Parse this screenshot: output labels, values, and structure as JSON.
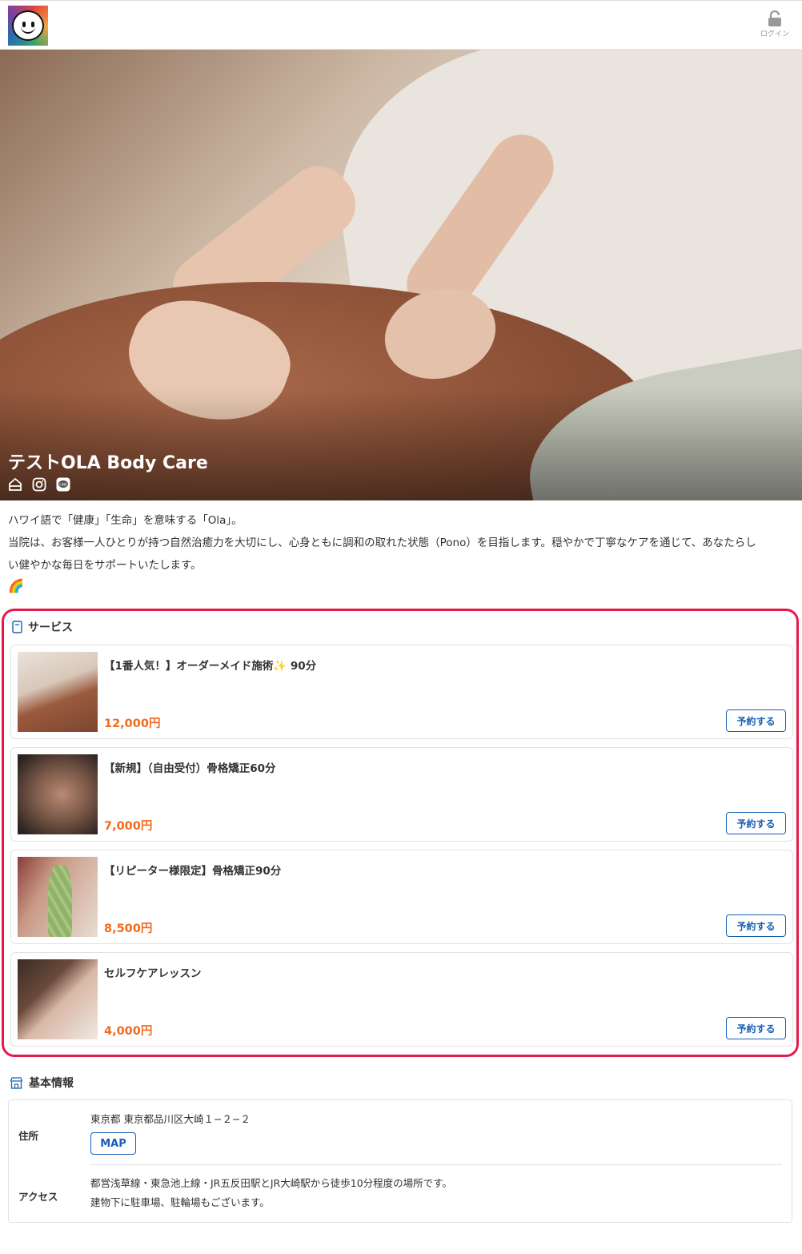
{
  "header": {
    "login_label": "ログイン"
  },
  "hero": {
    "shop_name": "テストOLA Body Care",
    "icons": [
      "home-icon",
      "instagram-icon",
      "line-icon"
    ]
  },
  "description": {
    "line1": "ハワイ語で「健康」「生命」を意味する「Ola」。",
    "line2": "当院は、お客様一人ひとりが持つ自然治癒力を大切にし、心身ともに調和の取れた状態（Pono）を目指します。穏やかで丁寧なケアを通じて、あなたらし",
    "line3": "い健やかな毎日をサポートいたします。",
    "emoji": "🌈"
  },
  "services": {
    "title": "サービス",
    "reserve_label": "予約する",
    "items": [
      {
        "name": "【1番人気！】オーダーメイド施術✨ 90分",
        "price": "12,000円"
      },
      {
        "name": "【新規】（自由受付）骨格矯正60分",
        "price": "7,000円"
      },
      {
        "name": "【リピーター様限定】骨格矯正90分",
        "price": "8,500円"
      },
      {
        "name": "セルフケアレッスン",
        "price": "4,000円"
      }
    ]
  },
  "basic_info": {
    "title": "基本情報",
    "address_label": "住所",
    "address": "東京都 東京都品川区大崎１−２−２",
    "map_label": "MAP",
    "access_label": "アクセス",
    "access_line1": "都営浅草線・東急池上線・JR五反田駅とJR大崎駅から徒歩10分程度の場所です。",
    "access_line2": "建物下に駐車場、駐輪場もございます。"
  },
  "colors": {
    "accent_blue": "#1a5fb4",
    "price_orange": "#f26a1b",
    "highlight_red": "#e5194a"
  }
}
